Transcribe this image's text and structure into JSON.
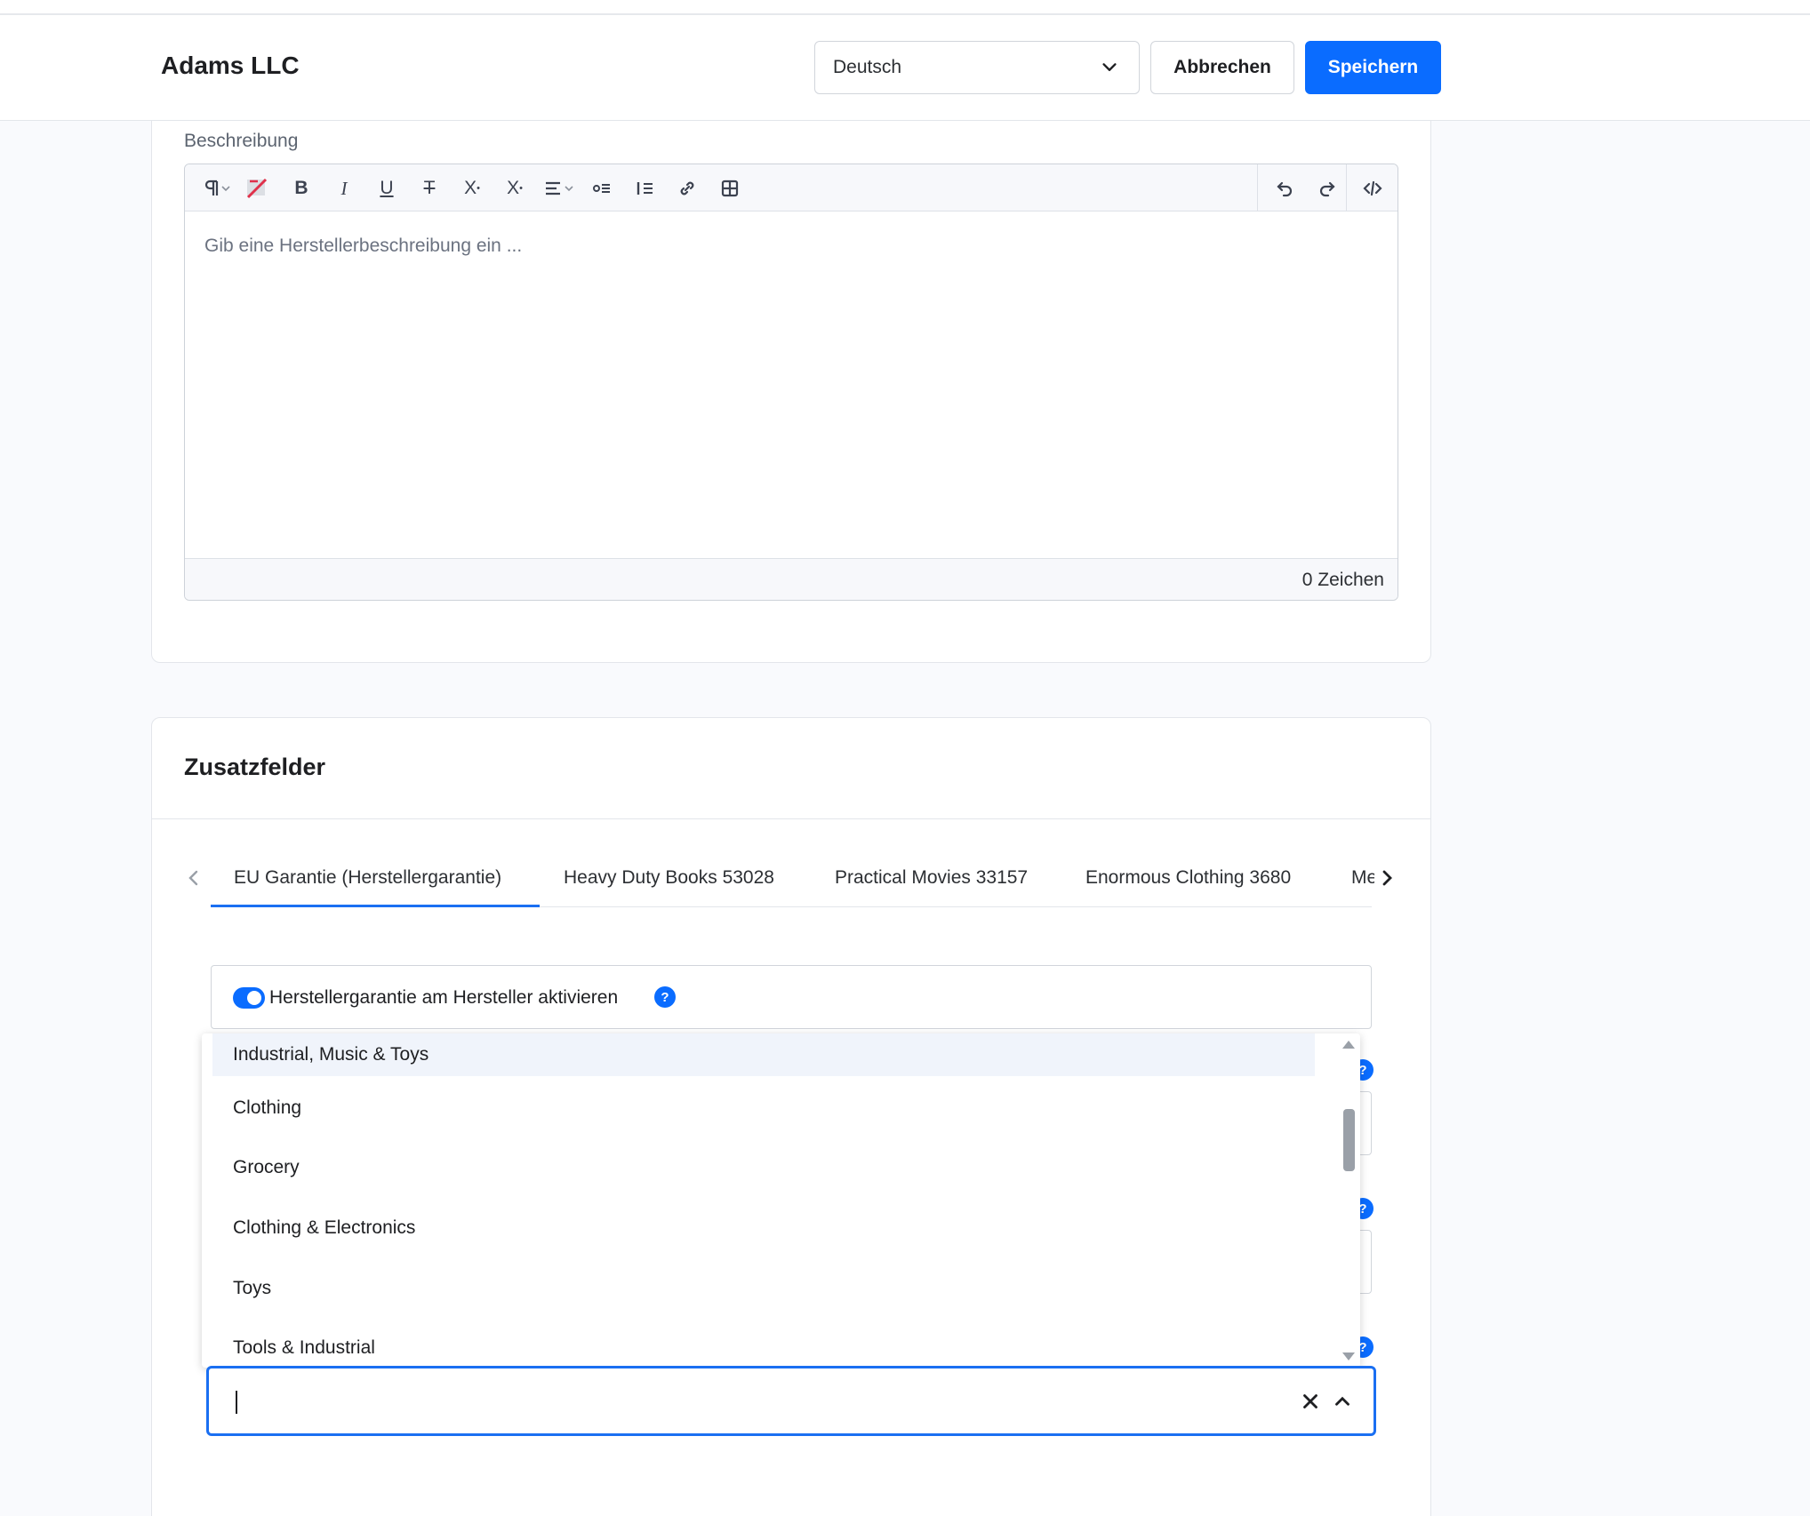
{
  "header": {
    "title": "Adams LLC",
    "language": {
      "selected": "Deutsch"
    },
    "cancel_label": "Abbrechen",
    "save_label": "Speichern"
  },
  "description": {
    "label": "Beschreibung",
    "placeholder": "Gib eine Herstellerbeschreibung ein ...",
    "char_count": "0 Zeichen",
    "toolbar_icons": [
      "paragraph-icon",
      "clear-format-icon",
      "bold-icon",
      "italic-icon",
      "underline-icon",
      "strikethrough-icon",
      "superscript-icon",
      "subscript-icon",
      "align-icon",
      "bullet-list-icon",
      "numbered-list-icon",
      "link-icon",
      "table-icon",
      "undo-icon",
      "redo-icon",
      "code-view-icon"
    ]
  },
  "custom_fields": {
    "title": "Zusatzfelder",
    "tabs": [
      {
        "label": "EU Garantie (Herstellergarantie)",
        "active": true
      },
      {
        "label": "Heavy Duty Books 53028",
        "active": false
      },
      {
        "label": "Practical Movies 33157",
        "active": false
      },
      {
        "label": "Enormous Clothing 3680",
        "active": false
      },
      {
        "label": "Me",
        "active": false
      }
    ],
    "toggle": {
      "label": "Herstellergarantie am Hersteller aktivieren",
      "on": true
    },
    "dropdown_options": [
      "Industrial, Music & Toys",
      "Clothing",
      "Grocery",
      "Clothing & Electronics",
      "Toys",
      "Tools & Industrial"
    ],
    "combo_value": ""
  },
  "colors": {
    "accent": "#0a6cff",
    "background": "#f9fafd"
  }
}
